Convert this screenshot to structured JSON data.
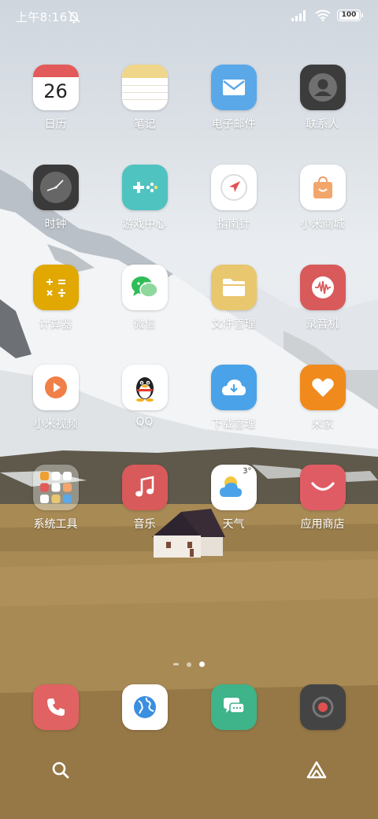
{
  "status_bar": {
    "time": "上午8:16",
    "battery_level": "100",
    "icons": [
      "mute-icon",
      "signal-icon",
      "wifi-icon",
      "battery-icon"
    ]
  },
  "apps": [
    {
      "label": "日历",
      "icon": "calendar-icon",
      "date": "26"
    },
    {
      "label": "笔记",
      "icon": "notes-icon"
    },
    {
      "label": "电子邮件",
      "icon": "email-icon"
    },
    {
      "label": "联系人",
      "icon": "contacts-icon"
    },
    {
      "label": "时钟",
      "icon": "clock-icon"
    },
    {
      "label": "游戏中心",
      "icon": "game-center-icon"
    },
    {
      "label": "指南针",
      "icon": "compass-icon"
    },
    {
      "label": "小米商城",
      "icon": "mi-store-icon"
    },
    {
      "label": "计算器",
      "icon": "calculator-icon"
    },
    {
      "label": "微信",
      "icon": "wechat-icon"
    },
    {
      "label": "文件管理",
      "icon": "file-manager-icon"
    },
    {
      "label": "录音机",
      "icon": "recorder-icon"
    },
    {
      "label": "小米视频",
      "icon": "mi-video-icon"
    },
    {
      "label": "QQ",
      "icon": "qq-icon"
    },
    {
      "label": "下载管理",
      "icon": "download-manager-icon"
    },
    {
      "label": "米家",
      "icon": "mijia-icon"
    },
    {
      "label": "系统工具",
      "icon": "system-tools-folder-icon"
    },
    {
      "label": "音乐",
      "icon": "music-icon"
    },
    {
      "label": "天气",
      "icon": "weather-icon",
      "temp": "3°"
    },
    {
      "label": "应用商店",
      "icon": "app-store-icon"
    }
  ],
  "page_indicator": {
    "pages": 3,
    "active": 3
  },
  "dock": [
    {
      "icon": "phone-icon"
    },
    {
      "icon": "browser-icon"
    },
    {
      "icon": "messages-icon"
    },
    {
      "icon": "camera-icon"
    }
  ],
  "bottom": {
    "left_icon": "search-icon",
    "right_icon": "app-drawer-icon"
  },
  "colors": {
    "calendar_red": "#e35a5a",
    "notes_yellow": "#f0d68a",
    "email_blue": "#5aa8e8",
    "contacts_dark": "#3c3c3c",
    "game_teal": "#4fc3c0",
    "calculator_gold": "#e0a800",
    "recorder_red": "#d85a5a",
    "download_blue": "#4aa3e8",
    "mijia_orange": "#f08a1c",
    "music_red": "#d85a5a",
    "appstore_red": "#e05c64",
    "phone_red": "#e06262",
    "messages_green": "#3fb389",
    "camera_dark": "#444444"
  }
}
